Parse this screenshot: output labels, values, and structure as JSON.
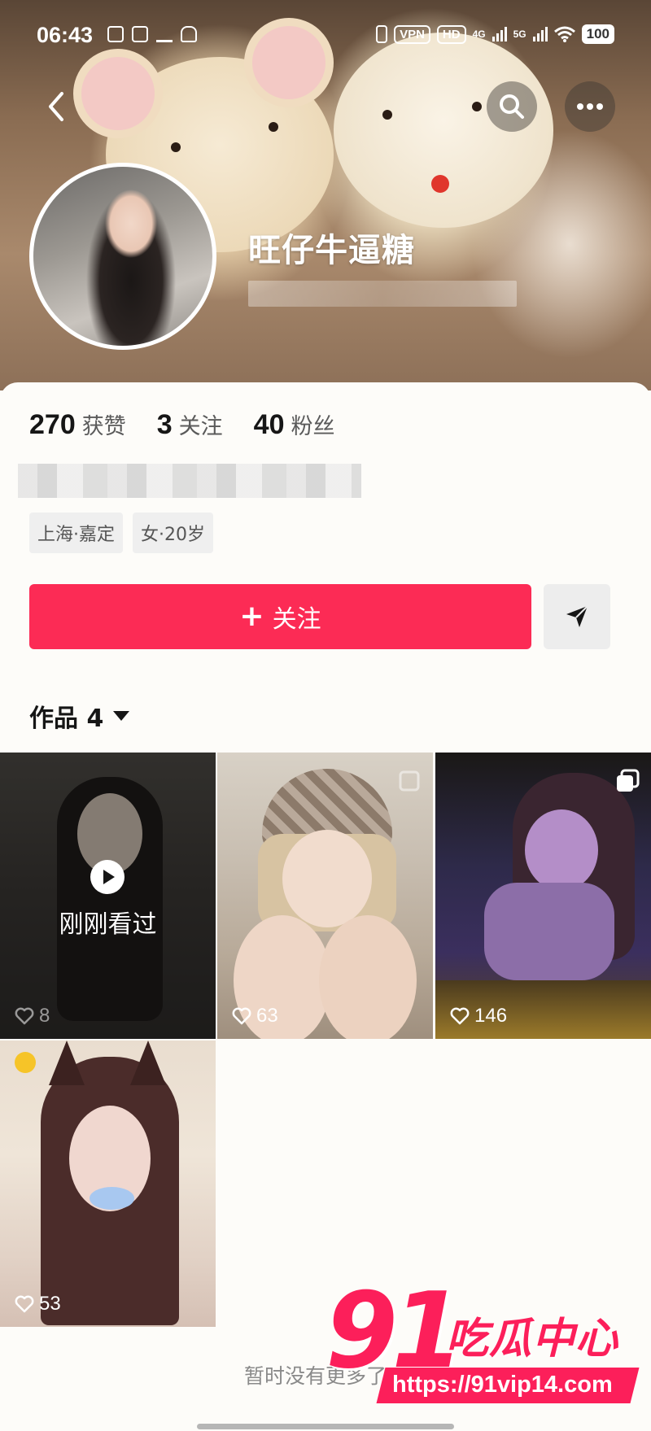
{
  "status_bar": {
    "time": "06:43",
    "vpn": "VPN",
    "hd": "HD",
    "net1": "4G",
    "net2": "5G",
    "battery": "100"
  },
  "profile": {
    "username": "旺仔牛逼糖"
  },
  "stats": {
    "likes_count": "270",
    "likes_label": "获赞",
    "following_count": "3",
    "following_label": "关注",
    "followers_count": "40",
    "followers_label": "粉丝"
  },
  "tags": [
    "上海·嘉定",
    "女·20岁"
  ],
  "actions": {
    "follow_label": "关注"
  },
  "works_tab": {
    "label": "作品 4"
  },
  "posts": [
    {
      "likes": "8",
      "overlay": "刚刚看过"
    },
    {
      "likes": "63"
    },
    {
      "likes": "146"
    },
    {
      "likes": "53"
    }
  ],
  "footer": {
    "no_more": "暂时没有更多了"
  },
  "watermark": {
    "brand_number": "91",
    "brand_text": "吃瓜中心",
    "url": "https://91vip14.com"
  },
  "colors": {
    "accent": "#fc2b55",
    "watermark": "#fc1f5a"
  }
}
